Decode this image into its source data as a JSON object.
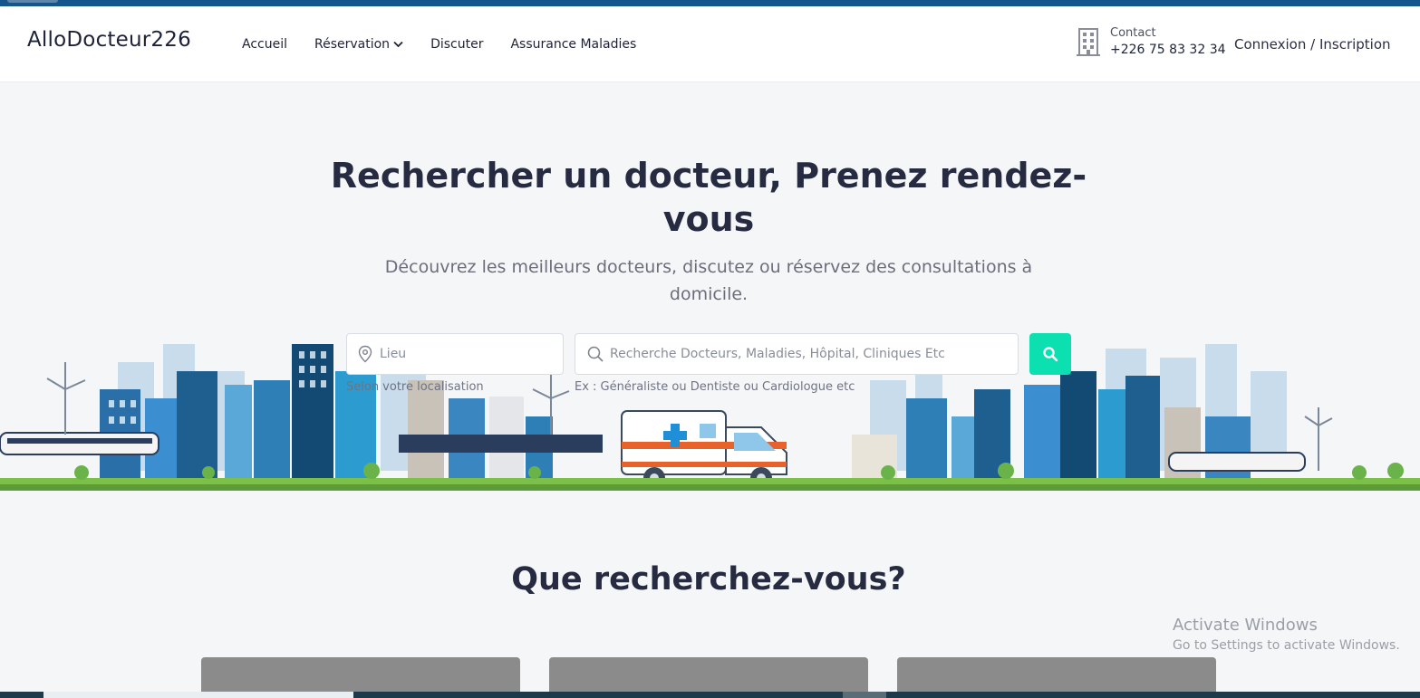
{
  "header": {
    "logo": "AlloDocteur226",
    "nav": [
      "Accueil",
      "Réservation",
      "Discuter",
      "Assurance Maladies"
    ],
    "contact_label": "Contact",
    "contact_phone": "+226 75 83 32 34",
    "login": "Connexion / Inscription"
  },
  "hero": {
    "title": "Rechercher un docteur, Prenez rendez-vous",
    "subtitle": "Découvrez les meilleurs docteurs, discutez ou réservez des consultations à domicile."
  },
  "search": {
    "location_placeholder": "Lieu",
    "location_hint": "Selon votre localisation",
    "query_placeholder": "Recherche Docteurs, Maladies, Hôpital, Cliniques Etc",
    "query_hint": "Ex : Généraliste ou Dentiste ou Cardiologue etc"
  },
  "section": {
    "title": "Que recherchez-vous?"
  },
  "watermark": {
    "line1": "Activate Windows",
    "line2": "Go to Settings to activate Windows."
  },
  "colors": {
    "accent": "#0de0b0",
    "topbar": "#15558d",
    "text": "#272b41"
  },
  "icons": [
    "chevron-down-icon",
    "building-icon",
    "location-pin-icon",
    "search-icon"
  ]
}
